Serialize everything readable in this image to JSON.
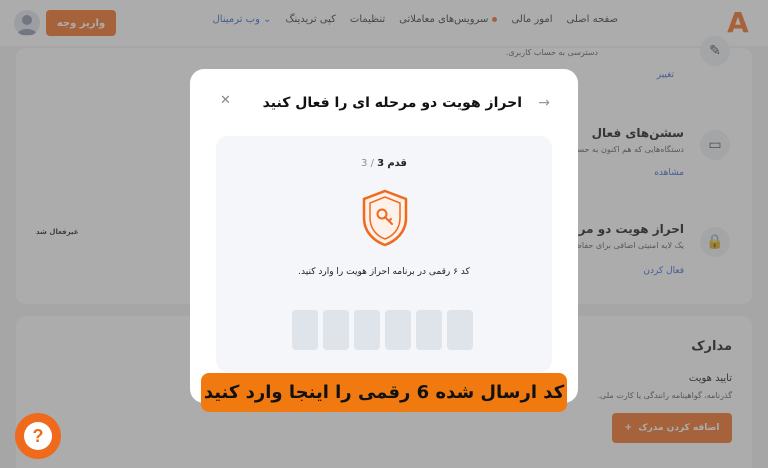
{
  "nav": {
    "logo": "A",
    "items": [
      "صفحه اصلی",
      "امور مالی",
      "سرویس‌های معاملاتی",
      "تنظیمات",
      "کپی تریدینگ"
    ],
    "terminal": "وب ترمینال",
    "deposit_button": "واریز وجه"
  },
  "background": {
    "access_desc": "دسترسی به حساب کاربری.",
    "change_link": "تغییر",
    "sessions_title": "سشن‌های فعال",
    "sessions_desc": "دستگاه‌هایی که هم اکنون به حساب",
    "sessions_link": "مشاهده",
    "twofa_title": "احراز هویت دو مرحله",
    "twofa_desc": "یک لایه امنیتی اضافی برای حفاظت",
    "twofa_link": "فعال کردن",
    "twofa_status": "غیرفعال شد",
    "docs_title": "مدارک",
    "identity_title": "تایید هویت",
    "identity_desc": "گذرنامه، گواهینامه رانندگی یا کارت ملی.",
    "add_doc_button": "اضافه کردن مدرک"
  },
  "modal": {
    "title": "احراز هویت دو مرحله ای را فعال کنید",
    "step_label": "قدم",
    "step_current": "3",
    "step_total": "3",
    "instruction": "کد ۶ رقمی در برنامه احراز هویت را وارد کنید.",
    "code_digits": [
      "",
      "",
      "",
      "",
      "",
      ""
    ]
  },
  "banner": "کد ارسال شده 6 رقمی را اینجا وارد کنید",
  "help_icon": "?",
  "colors": {
    "accent": "#f06a1d",
    "link": "#2f5fd0",
    "banner": "#f07a10"
  }
}
